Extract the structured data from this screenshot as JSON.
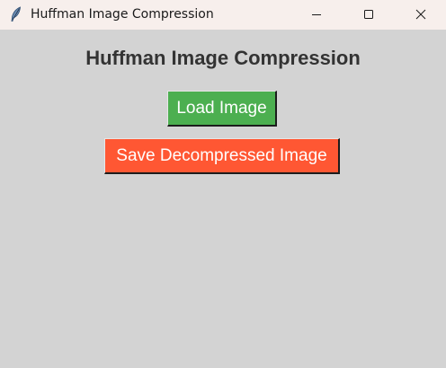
{
  "window": {
    "title": "Huffman Image Compression",
    "app_icon": "feather-icon",
    "controls": {
      "minimize_icon": "minimize-icon",
      "maximize_icon": "maximize-icon",
      "close_icon": "close-icon"
    }
  },
  "main": {
    "heading": "Huffman Image Compression",
    "load_button_label": "Load Image",
    "save_button_label": "Save Decompressed Image"
  },
  "colors": {
    "background": "#d3d3d3",
    "titlebar": "#f7efec",
    "load_button": "#4caf50",
    "save_button": "#ff5733",
    "heading_text": "#333333"
  }
}
